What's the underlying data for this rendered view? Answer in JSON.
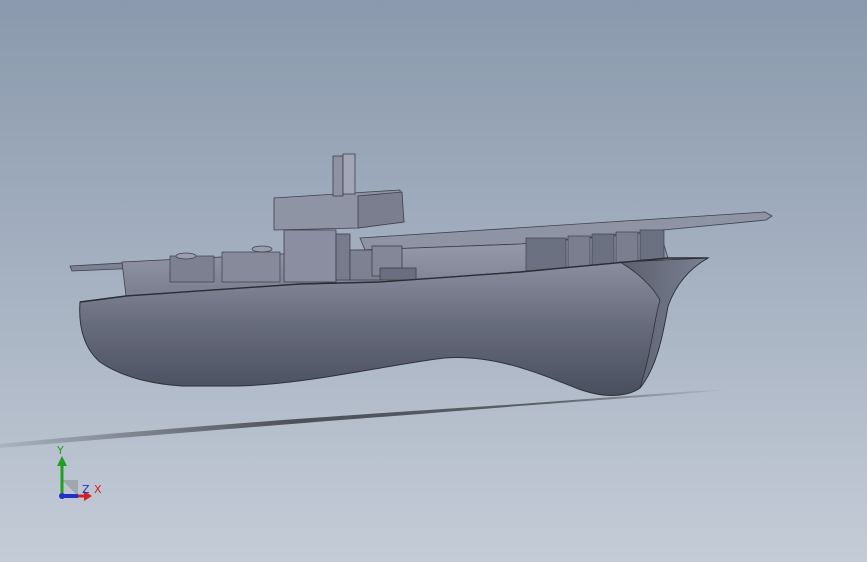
{
  "viewport": {
    "model": "ship-hull-assembly",
    "background": {
      "top": "#8a99ad",
      "bottom": "#c4ccd7"
    },
    "part_color": "#6e7383"
  },
  "triad": {
    "x_label": "X",
    "y_label": "Y",
    "z_label": "Z",
    "x_color": "#d42020",
    "y_color": "#1fa01f",
    "z_color": "#2030c8"
  }
}
